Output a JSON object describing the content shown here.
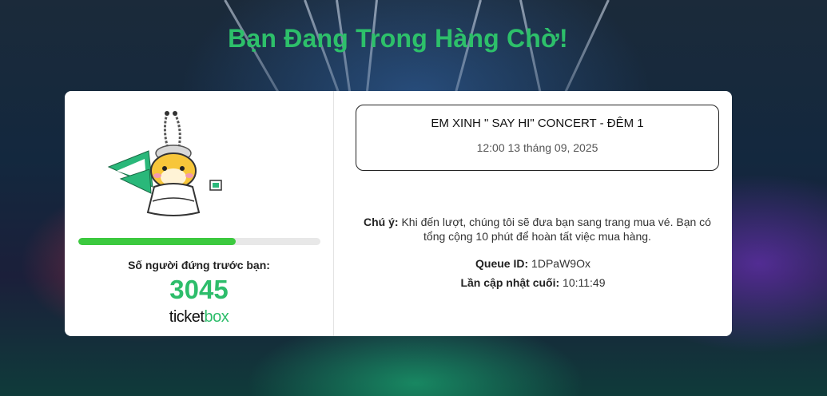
{
  "page": {
    "title": "Bạn Đang Trong Hàng Chờ!"
  },
  "queue": {
    "progress_fraction": 0.65,
    "ahead_label": "Số người đứng trước bạn:",
    "ahead_count": "3045",
    "logo_part1": "ticket",
    "logo_part2": "box"
  },
  "event": {
    "name": "EM XINH \" SAY HI\" CONCERT - ĐÊM 1",
    "datetime": "12:00 13 tháng 09, 2025"
  },
  "notice": {
    "label": "Chú ý:",
    "text": " Khi đến lượt, chúng tôi sẽ đưa bạn sang trang mua vé. Bạn có tổng cộng 10 phút để hoàn tất việc mua hàng."
  },
  "queue_id": {
    "label": "Queue ID:",
    "value": " 1DPaW9Ox"
  },
  "last_update": {
    "label": "Lần cập nhật cuối:",
    "value": " 10:11:49"
  },
  "colors": {
    "accent": "#2dbd6b",
    "progress": "#3cc93f",
    "title": "#2dc06a"
  }
}
